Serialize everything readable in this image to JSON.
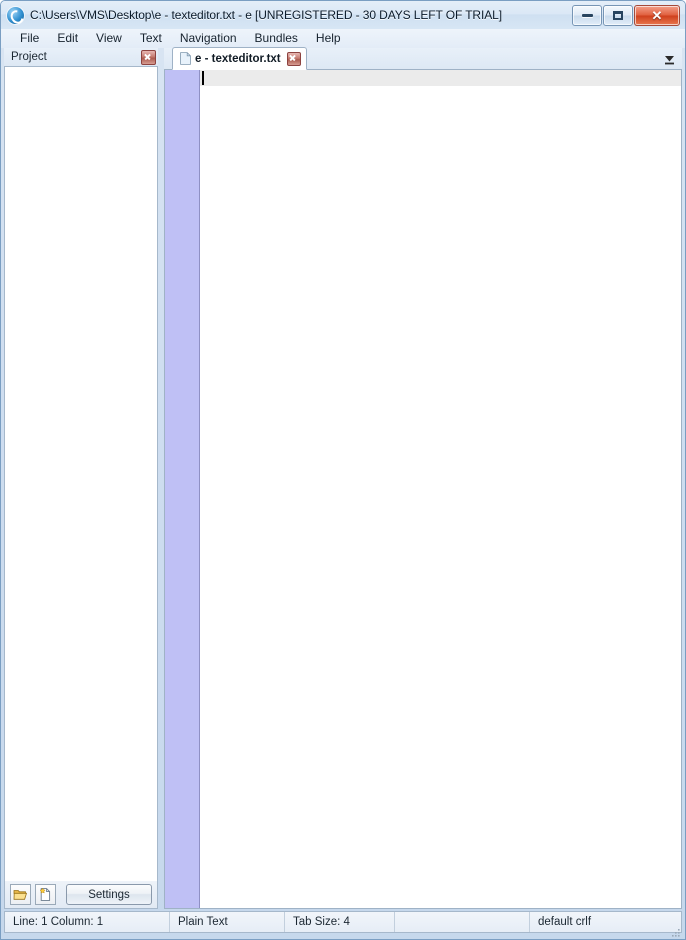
{
  "window": {
    "title": "C:\\Users\\VMS\\Desktop\\e - texteditor.txt - e  [UNREGISTERED - 30 DAYS LEFT OF TRIAL]",
    "app_icon": "e-circle-icon",
    "controls": {
      "minimize": "minimize-icon",
      "maximize": "maximize-icon",
      "close": "✕"
    }
  },
  "menubar": {
    "items": [
      {
        "label": "File"
      },
      {
        "label": "Edit"
      },
      {
        "label": "View"
      },
      {
        "label": "Text"
      },
      {
        "label": "Navigation"
      },
      {
        "label": "Bundles"
      },
      {
        "label": "Help"
      }
    ]
  },
  "project_panel": {
    "title": "Project",
    "close_icon": "close-icon",
    "tree_items": [],
    "toolbar": {
      "open_folder_icon": "open-folder-icon",
      "new_file_icon": "new-file-icon",
      "settings_label": "Settings"
    }
  },
  "editor": {
    "tabs": [
      {
        "label": "e - texteditor.txt",
        "file_icon": "document-icon",
        "close_icon": "close-icon",
        "active": true
      }
    ],
    "tab_overflow_icon": "chevron-down-icon",
    "gutter_color": "#bfc0f5",
    "current_line_color": "#ebebeb",
    "content": "",
    "caret": {
      "line": 1,
      "column": 1
    }
  },
  "statusbar": {
    "position": "Line: 1  Column: 1",
    "syntax": "Plain Text",
    "tab_size": "Tab Size: 4",
    "blank": "",
    "line_endings": "default crlf"
  },
  "colors": {
    "frame": "#cfdef0",
    "accent": "#bfc0f5",
    "close_red": "#cf3f1c",
    "border": "#a6b8cb"
  }
}
